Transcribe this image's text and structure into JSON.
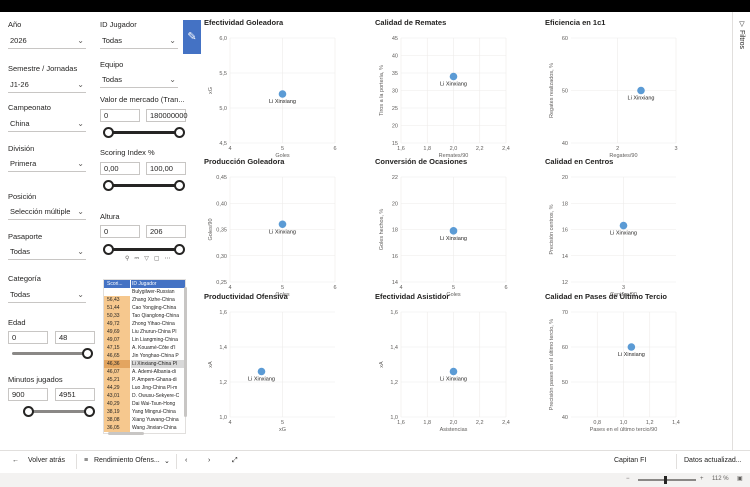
{
  "filters": {
    "anio": {
      "label": "Año",
      "value": "2026"
    },
    "semestre": {
      "label": "Semestre / Jornadas",
      "value": "J1-26"
    },
    "campeonato": {
      "label": "Campeonato",
      "value": "China"
    },
    "division": {
      "label": "División",
      "value": "Primera"
    },
    "posicion": {
      "label": "Posición",
      "value": "Selección múltiple"
    },
    "pasaporte": {
      "label": "Pasaporte",
      "value": "Todas"
    },
    "categoria": {
      "label": "Categoría",
      "value": "Todas"
    },
    "edad": {
      "label": "Edad",
      "min": "0",
      "max": "48"
    },
    "minutos": {
      "label": "Minutos jugados",
      "min": "900",
      "max": "4951"
    },
    "id_jugador": {
      "label": "ID Jugador",
      "value": "Todas"
    },
    "equipo": {
      "label": "Equipo",
      "value": "Todas"
    },
    "valor": {
      "label": "Valor de mercado (Tran...",
      "min": "0",
      "max": "180000000"
    },
    "scoring": {
      "label": "Scoring Index %",
      "min": "0,00",
      "max": "100,00"
    },
    "altura": {
      "label": "Altura",
      "min": "0",
      "max": "206"
    }
  },
  "table": {
    "headers": [
      "Scori...",
      "ID Jugador"
    ],
    "rows": [
      [
        "",
        "Bulygilwer-Russian"
      ],
      [
        "56,43",
        "Zhang Xizhe-China"
      ],
      [
        "51,44",
        "Cao Yongjing-China"
      ],
      [
        "50,33",
        "Tao Qianglong-China"
      ],
      [
        "49,72",
        "Zhong Yihao-China"
      ],
      [
        "49,69",
        "Liu Zhurun-China Pl"
      ],
      [
        "49,07",
        "Lin Liangming-China"
      ],
      [
        "47,15",
        "A. Kouamé-Côte d'I"
      ],
      [
        "46,65",
        "Jin Yonghao-China P"
      ],
      [
        "46,36",
        "Li Xinxiang-China Pl"
      ],
      [
        "46,07",
        "A. Ademi-Albania-di"
      ],
      [
        "45,21",
        "P. Ampem-Ghana-di"
      ],
      [
        "44,29",
        "Luo Jing-China Pl-m"
      ],
      [
        "43,01",
        "D. Owusu-Sekyere-C"
      ],
      [
        "40,29",
        "Dai Wai-Tsun-Hong"
      ],
      [
        "38,19",
        "Yang Mingrui-China"
      ],
      [
        "38,08",
        "Xiang Yuwang-China"
      ],
      [
        "36,05",
        "Wang Jinxian-China"
      ]
    ],
    "selected_index": 9
  },
  "side_panel": {
    "label": "Filtros"
  },
  "bottom_bar": {
    "back": "Volver atrás",
    "page": "Rendimiento Ofens...",
    "bookmark": "Capitan FI",
    "refresh": "Datos actualizad...",
    "zoom": "112 %"
  },
  "chart_data": [
    {
      "type": "scatter",
      "title": "Efectividad Goleadora",
      "xlabel": "Goles",
      "ylabel": "xG",
      "xlim": [
        4,
        6
      ],
      "ylim": [
        4.5,
        6
      ],
      "xticks": [
        "4",
        "5",
        "6"
      ],
      "yticks": [
        "4,5",
        "5,0",
        "5,5",
        "6,0"
      ],
      "points": [
        {
          "x": 5,
          "y": 5.2,
          "label": "Li Xinxiang"
        }
      ]
    },
    {
      "type": "scatter",
      "title": "Calidad de Remates",
      "xlabel": "Remates/90",
      "ylabel": "Tiros a la portería, %",
      "xlim": [
        1.6,
        2.4
      ],
      "ylim": [
        15,
        45
      ],
      "xticks": [
        "1,6",
        "1,8",
        "2,0",
        "2,2",
        "2,4"
      ],
      "yticks": [
        "15",
        "20",
        "25",
        "30",
        "35",
        "40",
        "45"
      ],
      "points": [
        {
          "x": 2.0,
          "y": 34,
          "label": "Li Xinxiang"
        }
      ]
    },
    {
      "type": "scatter",
      "title": "Eficiencia en 1c1",
      "xlabel": "Regates/90",
      "ylabel": "Regates realizados, %",
      "xlim": [
        1.2,
        3
      ],
      "ylim": [
        40,
        60
      ],
      "xticks": [
        "2",
        "3"
      ],
      "yticks": [
        "40",
        "50",
        "60"
      ],
      "points": [
        {
          "x": 2.4,
          "y": 50,
          "label": "Li Xinxiang"
        }
      ]
    },
    {
      "type": "scatter",
      "title": "Producción Goleadora",
      "xlabel": "Goles",
      "ylabel": "Goles/90",
      "xlim": [
        4,
        6
      ],
      "ylim": [
        0.25,
        0.45
      ],
      "xticks": [
        "4",
        "5",
        "6"
      ],
      "yticks": [
        "0,25",
        "0,30",
        "0,35",
        "0,40",
        "0,45"
      ],
      "points": [
        {
          "x": 5,
          "y": 0.36,
          "label": "Li Xinxiang"
        }
      ]
    },
    {
      "type": "scatter",
      "title": "Conversión de Ocasiones",
      "xlabel": "Goles",
      "ylabel": "Goles hechos, %",
      "xlim": [
        4,
        6
      ],
      "ylim": [
        14,
        22
      ],
      "xticks": [
        "4",
        "5",
        "6"
      ],
      "yticks": [
        "14",
        "16",
        "18",
        "20",
        "22"
      ],
      "points": [
        {
          "x": 5,
          "y": 17.9,
          "label": "Li Xinxiang"
        }
      ]
    },
    {
      "type": "scatter",
      "title": "Calidad en Centros",
      "xlabel": "Centros/90",
      "ylabel": "Precisión centros, %",
      "xlim": [
        2,
        4
      ],
      "ylim": [
        12,
        20
      ],
      "xticks": [
        "3"
      ],
      "yticks": [
        "12",
        "14",
        "16",
        "18",
        "20"
      ],
      "points": [
        {
          "x": 3.0,
          "y": 16.3,
          "label": "Li Xinxiang"
        }
      ]
    },
    {
      "type": "scatter",
      "title": "Productividad Ofensiva",
      "xlabel": "xG",
      "ylabel": "xA",
      "xlim": [
        4,
        6
      ],
      "ylim": [
        1.0,
        1.6
      ],
      "xticks": [
        "4",
        "5"
      ],
      "yticks": [
        "1,0",
        "1,2",
        "1,4",
        "1,6"
      ],
      "points": [
        {
          "x": 4.6,
          "y": 1.26,
          "label": "Li Xinxiang"
        }
      ]
    },
    {
      "type": "scatter",
      "title": "Efectividad Asistidor",
      "xlabel": "Asistencias",
      "ylabel": "xA",
      "xlim": [
        1.6,
        2.4
      ],
      "ylim": [
        1.0,
        1.6
      ],
      "xticks": [
        "1,6",
        "1,8",
        "2,0",
        "2,2",
        "2,4"
      ],
      "yticks": [
        "1,0",
        "1,2",
        "1,4",
        "1,6"
      ],
      "points": [
        {
          "x": 2.0,
          "y": 1.26,
          "label": "Li Xinxiang"
        }
      ]
    },
    {
      "type": "scatter",
      "title": "Calidad en Pases de Último Tercio",
      "xlabel": "Pases en el último tercio/90",
      "ylabel": "Precisión pases en el último tercio, %",
      "xlim": [
        0.6,
        1.4
      ],
      "ylim": [
        40,
        70
      ],
      "xticks": [
        "0,8",
        "1,0",
        "1,2",
        "1,4"
      ],
      "yticks": [
        "40",
        "50",
        "60",
        "70"
      ],
      "points": [
        {
          "x": 1.06,
          "y": 60,
          "label": "Li Xinxiang"
        }
      ]
    }
  ],
  "colors": {
    "point": "#5b9bd5",
    "table_header": "#4472c4",
    "score_cell": "#f6c88e"
  }
}
